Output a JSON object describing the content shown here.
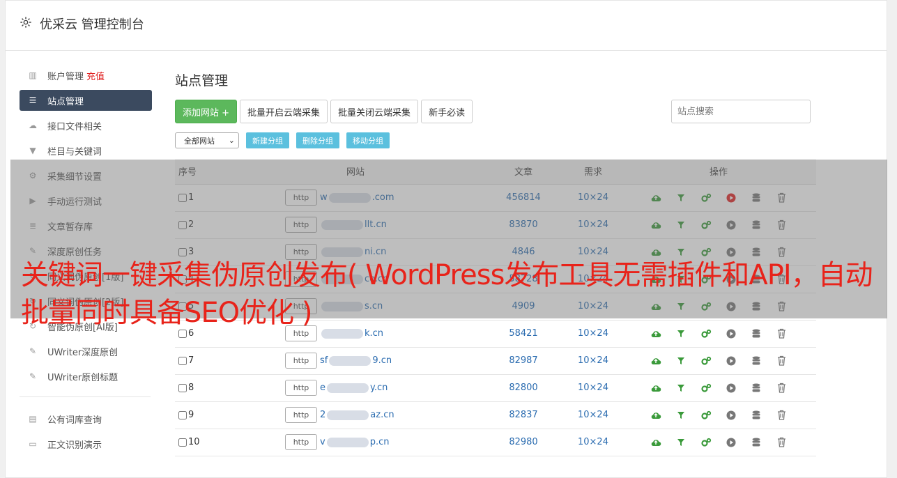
{
  "header": {
    "title": "优采云 管理控制台"
  },
  "sidebar": {
    "items": [
      {
        "label": "账户管理",
        "extra": "充值",
        "icon": "bar-chart-icon"
      },
      {
        "label": "站点管理",
        "icon": "server-icon",
        "active": true
      },
      {
        "label": "接口文件相关",
        "icon": "cloud-upload-icon"
      },
      {
        "label": "栏目与关键词",
        "icon": "filter-icon"
      },
      {
        "label": "采集细节设置",
        "icon": "gears-icon"
      },
      {
        "label": "手动运行测试",
        "icon": "play-icon"
      },
      {
        "label": "文章暂存库",
        "icon": "database-icon"
      },
      {
        "label": "深度原创任务",
        "icon": "edit-icon"
      },
      {
        "label": "",
        "icon": ""
      },
      {
        "label": "同义词伪原创[1版]",
        "icon": "refresh-icon"
      },
      {
        "label": "同义词伪原创[2版]",
        "icon": "refresh-icon"
      },
      {
        "label": "智能伪原创[AI版]",
        "icon": "refresh-icon"
      },
      {
        "label": "UWriter深度原创",
        "icon": "edit-icon"
      },
      {
        "label": "UWriter原创标题",
        "icon": "edit-icon"
      }
    ],
    "bottom_items": [
      {
        "label": "公有词库查询",
        "icon": "book-icon"
      },
      {
        "label": "正文识别演示",
        "icon": "monitor-icon"
      }
    ]
  },
  "main": {
    "title": "站点管理",
    "add_site": "添加网站 +",
    "batch_on": "批量开启云端采集",
    "batch_off": "批量关闭云端采集",
    "guide": "新手必读",
    "search_placeholder": "站点搜索",
    "group_select": "全部网站",
    "new_group": "新建分组",
    "delete_group": "删除分组",
    "move_group": "移动分组",
    "columns": {
      "num": "序号",
      "site": "网站",
      "articles": "文章",
      "demand": "需求",
      "ops": "操作"
    },
    "http_label": "http",
    "rows": [
      {
        "num": "1",
        "site_pre": "w",
        "site_post": ".com",
        "articles": "456814",
        "demand": "10×24",
        "active": true
      },
      {
        "num": "2",
        "site_pre": "",
        "site_post": "llt.cn",
        "articles": "83870",
        "demand": "10×24",
        "active": false
      },
      {
        "num": "3",
        "site_pre": "",
        "site_post": "ni.cn",
        "articles": "4846",
        "demand": "10×24",
        "active": false
      },
      {
        "num": "4",
        "site_pre": "",
        "site_post": "co.cn",
        "articles": "58728",
        "demand": "10×24",
        "active": false
      },
      {
        "num": "5",
        "site_pre": "",
        "site_post": "s.cn",
        "articles": "4909",
        "demand": "10×24",
        "active": false
      },
      {
        "num": "6",
        "site_pre": "",
        "site_post": "k.cn",
        "articles": "58421",
        "demand": "10×24",
        "active": false
      },
      {
        "num": "7",
        "site_pre": "sf",
        "site_post": "9.cn",
        "articles": "82987",
        "demand": "10×24",
        "active": false
      },
      {
        "num": "8",
        "site_pre": "e",
        "site_post": "y.cn",
        "articles": "82800",
        "demand": "10×24",
        "active": false
      },
      {
        "num": "9",
        "site_pre": "2",
        "site_post": "az.cn",
        "articles": "82837",
        "demand": "10×24",
        "active": false
      },
      {
        "num": "10",
        "site_pre": "v",
        "site_post": "p.cn",
        "articles": "82980",
        "demand": "10×24",
        "active": false
      }
    ]
  },
  "banner": {
    "text": "关键词一键采集伪原创发布( WordPress发布工具无需插件和API，自动批量同时具备SEO优化 )"
  },
  "colors": {
    "accent": "#3b4a5f",
    "green": "#5cb85c",
    "info": "#5bc0de",
    "banner": "#e8231a",
    "play_active": "#e02020"
  }
}
